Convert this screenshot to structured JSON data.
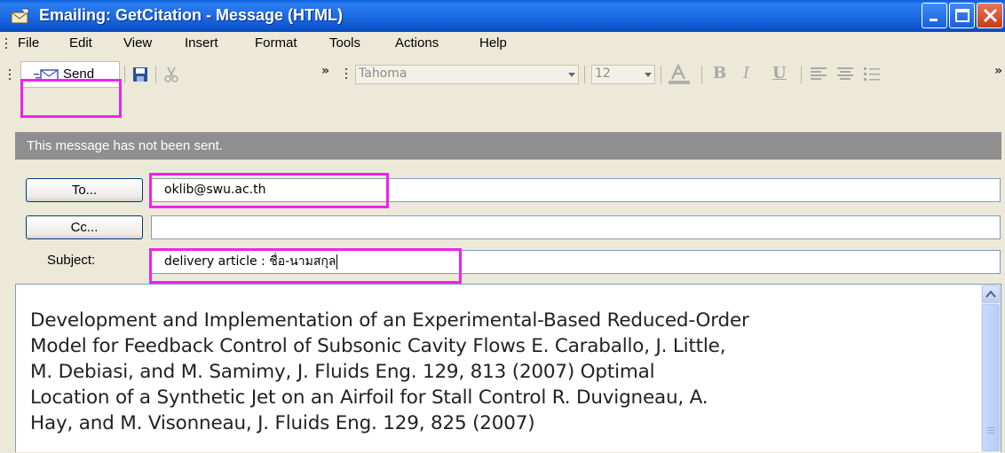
{
  "window": {
    "title": "Emailing: GetCitation - Message (HTML)",
    "title_bar_color": "#1f6be3"
  },
  "menu": {
    "items": [
      "File",
      "Edit",
      "View",
      "Insert",
      "Format",
      "Tools",
      "Actions",
      "Help"
    ]
  },
  "toolbar": {
    "send_label": "Send",
    "font_name": "Tahoma",
    "font_size": "12",
    "bold_label": "B",
    "italic_label": "I",
    "underline_label": "U",
    "icons": [
      "send-icon",
      "save-icon",
      "cut-icon",
      "font-color-icon",
      "align-left-icon",
      "align-center-icon",
      "bullets-icon"
    ]
  },
  "info_bar": {
    "text": "This message has not been sent."
  },
  "fields": {
    "to_button": "To...",
    "to_value": "oklib@swu.ac.th",
    "cc_button": "Cc...",
    "cc_value": "",
    "subject_label": "Subject:",
    "subject_value": "delivery article : ชื่อ-นามสกุล"
  },
  "message": {
    "body": "Development and Implementation of an Experimental-Based Reduced-Order\nModel for Feedback Control of Subsonic Cavity Flows E. Caraballo, J. Little,\nM. Debiasi, and M. Samimy, J. Fluids Eng. 129, 813 (2007) Optimal\nLocation of a Synthetic Jet on an Airfoil for Stall Control R. Duvigneau, A.\nHay, and M. Visonneau, J. Fluids Eng. 129, 825 (2007)"
  },
  "colors": {
    "highlight": "#ee22ee",
    "info_bar": "#8f8f8f"
  }
}
